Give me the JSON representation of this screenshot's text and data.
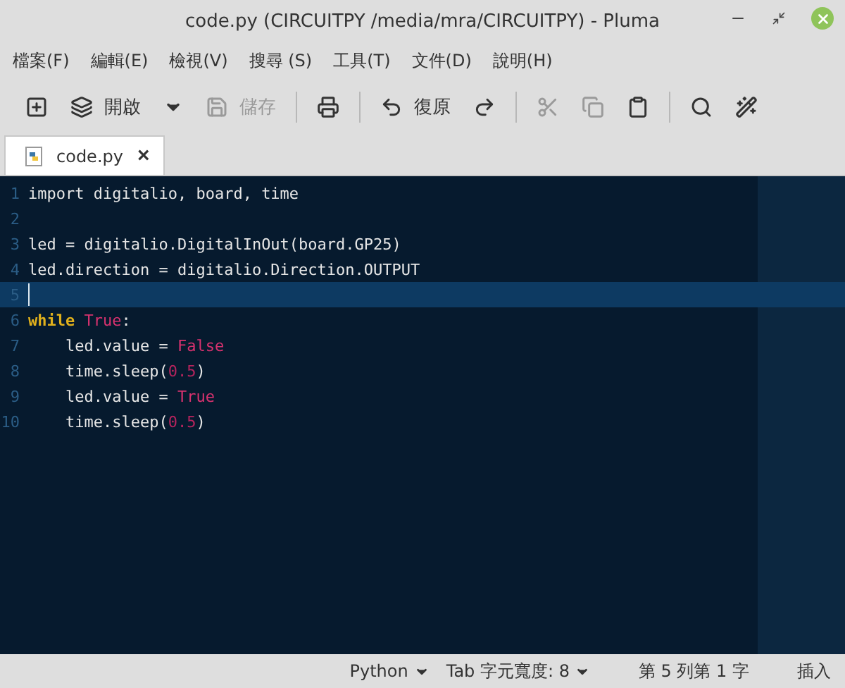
{
  "window": {
    "title": "code.py (CIRCUITPY /media/mra/CIRCUITPY) - Pluma"
  },
  "menu": [
    "檔案(F)",
    "編輯(E)",
    "檢視(V)",
    "搜尋 (S)",
    "工具(T)",
    "文件(D)",
    "說明(H)"
  ],
  "toolbar": [
    {
      "kind": "new",
      "disabled": false
    },
    {
      "kind": "open",
      "label": "開啟",
      "disabled": false
    },
    {
      "kind": "dropdown",
      "disabled": false
    },
    {
      "kind": "save",
      "label": "儲存",
      "disabled": true
    },
    {
      "kind": "separator"
    },
    {
      "kind": "print",
      "disabled": false
    },
    {
      "kind": "separator"
    },
    {
      "kind": "undo",
      "label": "復原",
      "disabled": false
    },
    {
      "kind": "redo",
      "disabled": false
    },
    {
      "kind": "separator"
    },
    {
      "kind": "cut",
      "disabled": true
    },
    {
      "kind": "copy",
      "disabled": true
    },
    {
      "kind": "paste",
      "disabled": false
    },
    {
      "kind": "separator"
    },
    {
      "kind": "find",
      "disabled": false
    },
    {
      "kind": "replace",
      "disabled": false
    }
  ],
  "tabs": [
    {
      "label": "code.py",
      "close": "×",
      "selected": true
    }
  ],
  "editor": {
    "lines": [
      {
        "number": "1",
        "current": false,
        "tokens": [
          {
            "kind": "plain",
            "text": "import digitalio, board, time"
          }
        ]
      },
      {
        "number": "2",
        "current": false
      },
      {
        "number": "3",
        "current": false,
        "tokens": [
          {
            "kind": "plain",
            "text": "led = digitalio.DigitalInOut(board.GP25)"
          }
        ]
      },
      {
        "number": "4",
        "current": false,
        "tokens": [
          {
            "kind": "plain",
            "text": "led.direction = digitalio.Direction.OUTPUT"
          }
        ]
      },
      {
        "number": "5",
        "current": true
      },
      {
        "number": "6",
        "current": false,
        "tokens": [
          {
            "kind": "keyword",
            "text": "while"
          },
          {
            "kind": "constant",
            "text": "True"
          },
          {
            "kind": "plain",
            "text": ":"
          }
        ]
      },
      {
        "number": "7",
        "current": false,
        "tokens": [
          {
            "kind": "plain",
            "text": "    led.value = "
          },
          {
            "kind": "constant",
            "text": "False"
          }
        ]
      },
      {
        "number": "8",
        "current": false,
        "tokens": [
          {
            "kind": "plain",
            "text": "    time.sleep("
          },
          {
            "kind": "number",
            "text": "0.5"
          },
          {
            "kind": "plain",
            "text": ")"
          }
        ]
      },
      {
        "number": "9",
        "current": false,
        "tokens": [
          {
            "kind": "plain",
            "text": "    led.value = "
          },
          {
            "kind": "constant",
            "text": "True"
          }
        ]
      },
      {
        "number": "10",
        "current": false,
        "tokens": [
          {
            "kind": "plain",
            "text": "    time.sleep("
          },
          {
            "kind": "number",
            "text": "0.5"
          },
          {
            "kind": "plain",
            "text": ")"
          }
        ]
      }
    ]
  },
  "status_bar": {
    "language": "Python",
    "tab_width": "Tab 字元寬度: 8",
    "position": "第 5 列第 1 字",
    "mode": "插入"
  }
}
